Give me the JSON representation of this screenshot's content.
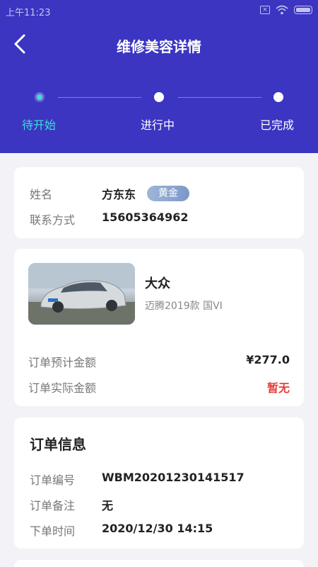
{
  "status_bar": {
    "time": "上午11:23",
    "icons": [
      "sim-icon",
      "wifi-icon",
      "battery-icon"
    ]
  },
  "header": {
    "title": "维修美容详情",
    "back_icon": "chevron-left-icon",
    "background": "#3b35c2"
  },
  "steps": [
    {
      "label": "待开始",
      "active": true
    },
    {
      "label": "进行中",
      "active": false
    },
    {
      "label": "已完成",
      "active": false
    }
  ],
  "colors": {
    "active_step": "#3de0d0",
    "price_red": "#e5403a"
  },
  "customer": {
    "name_label": "姓名",
    "name": "方东东",
    "level": "黄金",
    "contact_label": "联系方式",
    "phone": "15605364962"
  },
  "vehicle": {
    "brand": "大众",
    "model": "迈腾2019款 国VI",
    "estimated_label": "订单预计金额",
    "estimated_value": "¥277.0",
    "actual_label": "订单实际金额",
    "actual_value": "暂无"
  },
  "order": {
    "title": "订单信息",
    "number_label": "订单编号",
    "number": "WBM20201230141517",
    "remark_label": "订单备注",
    "remark": "无",
    "time_label": "下单时间",
    "time": "2020/12/30 14:15"
  }
}
